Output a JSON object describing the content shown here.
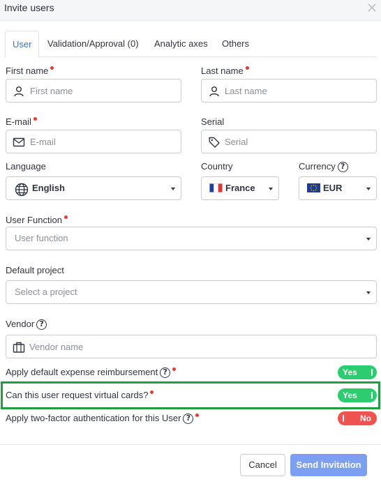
{
  "dialog": {
    "title": "Invite users"
  },
  "tabs": [
    {
      "label": "User",
      "active": true
    },
    {
      "label": "Validation/Approval (0)",
      "active": false
    },
    {
      "label": "Analytic axes",
      "active": false
    },
    {
      "label": "Others",
      "active": false
    }
  ],
  "form": {
    "first_name": {
      "label": "First name",
      "placeholder": "First name",
      "required": true
    },
    "last_name": {
      "label": "Last name",
      "placeholder": "Last name",
      "required": true
    },
    "email": {
      "label": "E-mail",
      "placeholder": "E-mail",
      "required": true
    },
    "serial": {
      "label": "Serial",
      "placeholder": "Serial"
    },
    "language": {
      "label": "Language",
      "value": "English"
    },
    "country": {
      "label": "Country",
      "value": "France"
    },
    "currency": {
      "label": "Currency",
      "value": "EUR"
    },
    "user_function": {
      "label": "User Function",
      "placeholder": "User function",
      "required": true
    },
    "default_project": {
      "label": "Default project",
      "placeholder": "Select a project"
    },
    "vendor": {
      "label": "Vendor",
      "placeholder": "Vendor name"
    }
  },
  "toggles": {
    "expense_reimbursement": {
      "label": "Apply default expense reimbursement",
      "value": "Yes",
      "on": true
    },
    "virtual_cards": {
      "label": "Can this user request virtual cards?",
      "value": "Yes",
      "on": true
    },
    "two_factor": {
      "label": "Apply two-factor authentication for this User",
      "value": "No",
      "on": false
    }
  },
  "footer": {
    "cancel_label": "Cancel",
    "send_label": "Send Invitation"
  },
  "colors": {
    "accent": "#3f6fd8",
    "toggle_on": "#2ecc71",
    "toggle_off": "#ef5350",
    "highlight": "#1e9e3f",
    "send_button": "#7d9ff2",
    "required": "#e23a3a"
  },
  "icons": {
    "close": "close-icon",
    "user": "user-icon",
    "mail": "mail-icon",
    "tag": "tag-icon",
    "globe": "globe-icon",
    "briefcase": "briefcase-icon",
    "help": "help-icon"
  }
}
